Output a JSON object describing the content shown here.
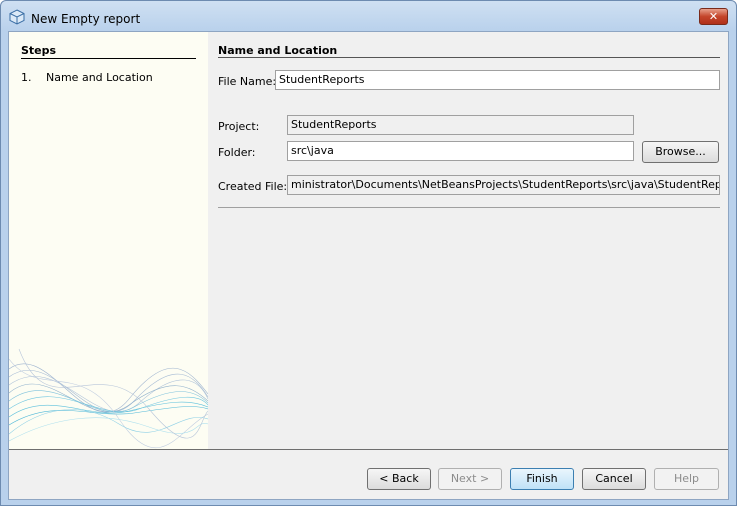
{
  "window": {
    "title": "New Empty report",
    "close_label": "✕"
  },
  "steps": {
    "header": "Steps",
    "items": [
      {
        "num": "1.",
        "label": "Name and Location"
      }
    ]
  },
  "main": {
    "header": "Name and Location",
    "file_name_label": "File Name:",
    "file_name_value": "StudentReports",
    "project_label": "Project:",
    "project_value": "StudentReports",
    "folder_label": "Folder:",
    "folder_value": "src\\java",
    "browse_label": "Browse...",
    "created_file_label": "Created File:",
    "created_file_value": "ministrator\\Documents\\NetBeansProjects\\StudentReports\\src\\java\\StudentReports.jrxml"
  },
  "buttons": {
    "back": "< Back",
    "next": "Next >",
    "finish": "Finish",
    "cancel": "Cancel",
    "help": "Help"
  }
}
